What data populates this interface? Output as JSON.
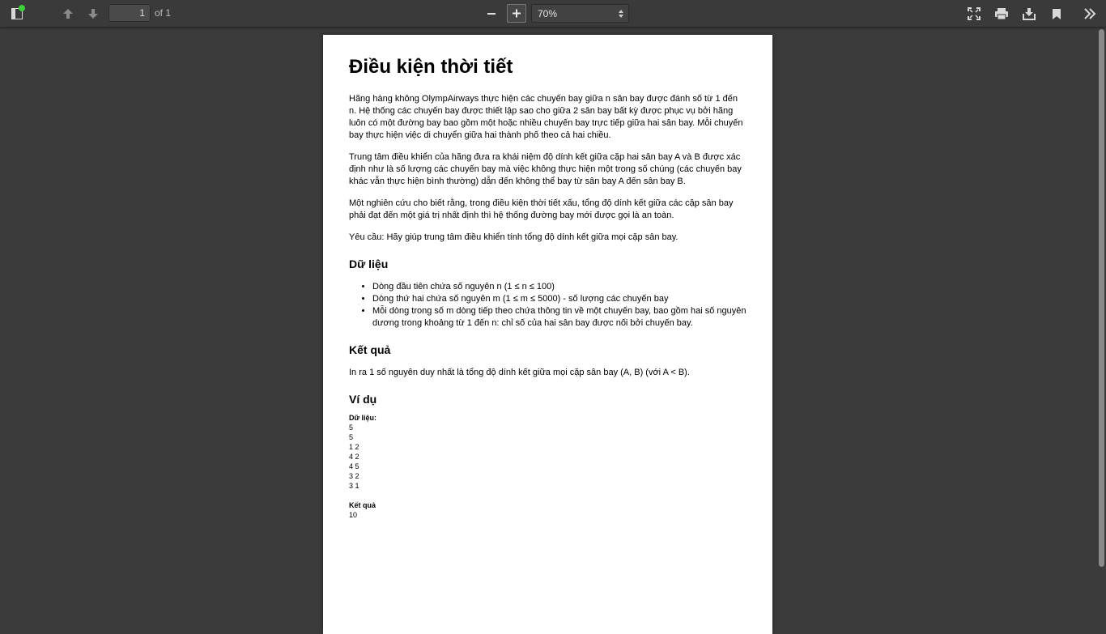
{
  "toolbar": {
    "page_number": "1",
    "page_total": "of 1",
    "zoom_value": "70%",
    "icons": [
      "sidebar-toggle-icon",
      "previous-page-icon",
      "next-page-icon",
      "zoom-out-icon",
      "zoom-in-icon",
      "presentation-mode-icon",
      "print-icon",
      "download-icon",
      "bookmark-icon",
      "more-tools-icon"
    ]
  },
  "doc": {
    "title": "Điều kiện thời tiết",
    "p1": "Hãng hàng không OlympAirways thực hiện các chuyến bay giữa n sân bay được đánh số từ 1 đến n. Hệ thống các chuyến bay được thiết lập sao cho giữa 2 sân bay bất kỳ được phục vụ bởi hãng luôn có một đường bay bao gồm một hoặc nhiều chuyến bay trực tiếp giữa hai sân bay. Mỗi chuyến bay thực hiện việc di chuyển giữa hai thành phố theo cả hai chiều.",
    "p2": "Trung tâm điều khiển của hãng đưa ra khái niệm độ dính kết giữa cặp hai sân bay A và B được xác định như là số lượng các chuyến bay mà việc không thực hiện một trong số chúng (các chuyến bay khác vẫn thực hiện bình thường) dẫn đến không thể bay từ sân bay A đến sân bay B.",
    "p3": "Một nghiên cứu cho biết rằng, trong điều kiện thời tiết xấu, tổng độ dính kết giữa các cặp sân bay phải đạt đến một giá trị nhất định thì hệ thống đường bay mới được gọi là an toàn.",
    "p4": "Yêu cầu: Hãy giúp trung tâm điều khiển tính tổng độ dính kết giữa mọi cặp sân bay.",
    "h_input": "Dữ liệu",
    "input_items": [
      "Dòng đầu tiên chứa số nguyên n (1 ≤ n ≤ 100)",
      "Dòng thứ hai chứa số nguyên m (1 ≤ m ≤ 5000) - số lượng các chuyến bay",
      "Mỗi dòng trong số m dòng tiếp theo chứa thông tin về một chuyến bay, bao gồm hai số nguyên dương trong khoảng từ 1 đến n: chỉ số của hai sân bay được nối bởi chuyến bay."
    ],
    "h_output": "Kết quả",
    "p_output": "In ra 1 số nguyên duy nhất là tổng độ dính kết giữa mọi cặp sân bay (A, B) (với A < B).",
    "h_example": "Ví dụ",
    "sample_input_label": "Dữ liệu:",
    "sample_input": [
      "5",
      "5",
      "1 2",
      "4 2",
      "4 5",
      "3 2",
      "3 1"
    ],
    "sample_output_label": "Kết quả",
    "sample_output": [
      "10"
    ]
  }
}
